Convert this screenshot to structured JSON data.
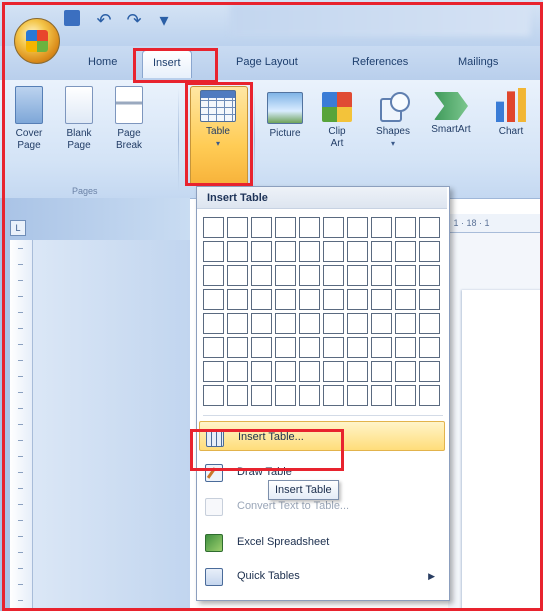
{
  "tabs": [
    "Home",
    "Insert",
    "Page Layout",
    "References",
    "Mailings"
  ],
  "ribbon": {
    "cover_page": "Cover\nPage",
    "blank_page": "Blank\nPage",
    "page_break": "Page\nBreak",
    "pages_group": "Pages",
    "table": "Table",
    "picture": "Picture",
    "clip_art": "Clip\nArt",
    "shapes": "Shapes",
    "smartart": "SmartArt",
    "chart": "Chart"
  },
  "dropdown": {
    "title": "Insert Table",
    "grid_columns": 10,
    "grid_rows": 8,
    "items": [
      {
        "label": "Insert Table...",
        "icon": "table-icon",
        "state": "hover"
      },
      {
        "label": "Draw Table",
        "icon": "pencil-icon",
        "state": "normal"
      },
      {
        "label": "Convert Text to Table...",
        "icon": "convert-icon",
        "state": "disabled"
      },
      {
        "label": "Excel Spreadsheet",
        "icon": "excel-icon",
        "state": "normal"
      },
      {
        "label": "Quick Tables",
        "icon": "quick-tables-icon",
        "state": "submenu"
      }
    ]
  },
  "tooltip": "Insert Table",
  "ruler": {
    "corner": "L",
    "h_text": "· 1 · 18 · 1"
  },
  "colors": {
    "highlight": "#e8232e",
    "hover": "#ffdd7a",
    "ribbon": "#d3e3f6"
  }
}
